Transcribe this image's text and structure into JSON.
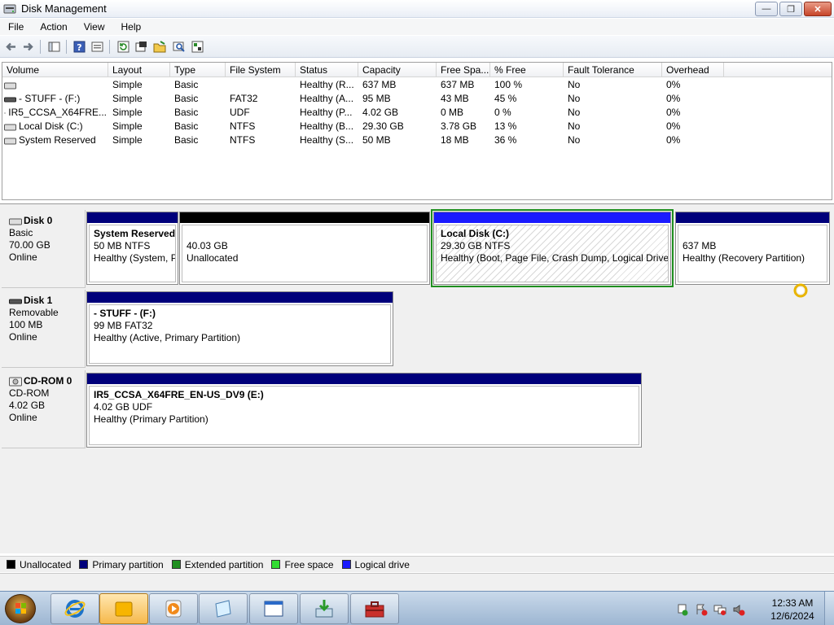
{
  "window": {
    "title": "Disk Management",
    "controls": {
      "minimize": "—",
      "restore": "❐",
      "close": "✕"
    }
  },
  "menu": [
    "File",
    "Action",
    "View",
    "Help"
  ],
  "toolbar": {
    "icons": [
      "back-icon",
      "forward-icon",
      "show-hide-icon",
      "help-icon",
      "properties-icon",
      "refresh-icon",
      "rescan-icon",
      "open-icon",
      "explore-icon",
      "settings-icon"
    ]
  },
  "volume_list": {
    "columns": [
      "Volume",
      "Layout",
      "Type",
      "File System",
      "Status",
      "Capacity",
      "Free Spa...",
      "% Free",
      "Fault Tolerance",
      "Overhead"
    ],
    "rows": [
      {
        "volume": "",
        "layout": "Simple",
        "type": "Basic",
        "fs": "",
        "status": "Healthy (R...",
        "capacity": "637 MB",
        "free": "637 MB",
        "pct": "100 %",
        "fault": "No",
        "overhead": "0%"
      },
      {
        "volume": "- STUFF - (F:)",
        "layout": "Simple",
        "type": "Basic",
        "fs": "FAT32",
        "status": "Healthy (A...",
        "capacity": "95 MB",
        "free": "43 MB",
        "pct": "45 %",
        "fault": "No",
        "overhead": "0%"
      },
      {
        "volume": "IR5_CCSA_X64FRE...",
        "layout": "Simple",
        "type": "Basic",
        "fs": "UDF",
        "status": "Healthy (P...",
        "capacity": "4.02 GB",
        "free": "0 MB",
        "pct": "0 %",
        "fault": "No",
        "overhead": "0%"
      },
      {
        "volume": "Local Disk (C:)",
        "layout": "Simple",
        "type": "Basic",
        "fs": "NTFS",
        "status": "Healthy (B...",
        "capacity": "29.30 GB",
        "free": "3.78 GB",
        "pct": "13 %",
        "fault": "No",
        "overhead": "0%"
      },
      {
        "volume": "System Reserved",
        "layout": "Simple",
        "type": "Basic",
        "fs": "NTFS",
        "status": "Healthy (S...",
        "capacity": "50 MB",
        "free": "18 MB",
        "pct": "36 %",
        "fault": "No",
        "overhead": "0%"
      }
    ]
  },
  "disks": [
    {
      "name": "Disk 0",
      "kind": "Basic",
      "size": "70.00 GB",
      "state": "Online",
      "partitions": [
        {
          "title": "System Reserved",
          "line2": "50 MB NTFS",
          "line3": "Healthy (System, P"
        },
        {
          "title": "",
          "line2": "40.03 GB",
          "line3": "Unallocated"
        },
        {
          "title": "Local Disk  (C:)",
          "line2": "29.30 GB NTFS",
          "line3": "Healthy (Boot, Page File, Crash Dump, Logical Drive)"
        },
        {
          "title": "",
          "line2": "637 MB",
          "line3": "Healthy (Recovery Partition)"
        }
      ]
    },
    {
      "name": "Disk 1",
      "kind": "Removable",
      "size": "100 MB",
      "state": "Online",
      "partitions": [
        {
          "title": "- STUFF -  (F:)",
          "line2": "99 MB FAT32",
          "line3": "Healthy (Active, Primary Partition)"
        }
      ]
    },
    {
      "name": "CD-ROM 0",
      "kind": "CD-ROM",
      "size": "4.02 GB",
      "state": "Online",
      "partitions": [
        {
          "title": "IR5_CCSA_X64FRE_EN-US_DV9  (E:)",
          "line2": "4.02 GB UDF",
          "line3": "Healthy (Primary Partition)"
        }
      ]
    }
  ],
  "legend": [
    {
      "label": "Unallocated",
      "color": "#000000"
    },
    {
      "label": "Primary partition",
      "color": "#00007b"
    },
    {
      "label": "Extended partition",
      "color": "#1f8f1f"
    },
    {
      "label": "Free space",
      "color": "#33dd33"
    },
    {
      "label": "Logical drive",
      "color": "#1a1aff"
    }
  ],
  "colors": {
    "primary": "#00007b",
    "unallocated": "#000000",
    "logical": "#1a1aff",
    "selection": "#1f8f1f"
  },
  "taskbar": {
    "pinned": [
      "internet-explorer-icon",
      "file-explorer-icon",
      "media-player-icon",
      "notepad-icon",
      "window-icon",
      "download-icon",
      "toolbox-icon"
    ],
    "clock": {
      "time": "12:33 AM",
      "date": "12/6/2024"
    }
  }
}
